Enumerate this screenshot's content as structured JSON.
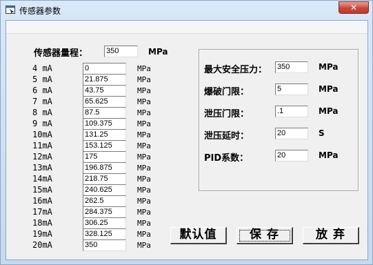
{
  "window": {
    "title": "传感器参数",
    "close_label": "✕"
  },
  "range": {
    "label": "传感器量程：",
    "value": "350",
    "unit": "MPa"
  },
  "table": {
    "rows": [
      {
        "label": "4 mA",
        "value": "0",
        "unit": "MPa"
      },
      {
        "label": "5 mA",
        "value": "21.875",
        "unit": "MPa"
      },
      {
        "label": "6 mA",
        "value": "43.75",
        "unit": "MPa"
      },
      {
        "label": "7 mA",
        "value": "65.625",
        "unit": "MPa"
      },
      {
        "label": "8 mA",
        "value": "87.5",
        "unit": "MPa"
      },
      {
        "label": "9 mA",
        "value": "109.375",
        "unit": "MPa"
      },
      {
        "label": "10mA",
        "value": "131.25",
        "unit": "MPa"
      },
      {
        "label": "11mA",
        "value": "153.125",
        "unit": "MPa"
      },
      {
        "label": "12mA",
        "value": "175",
        "unit": "MPa"
      },
      {
        "label": "13mA",
        "value": "196.875",
        "unit": "MPa"
      },
      {
        "label": "14mA",
        "value": "218.75",
        "unit": "MPa"
      },
      {
        "label": "15mA",
        "value": "240.625",
        "unit": "MPa"
      },
      {
        "label": "16mA",
        "value": "262.5",
        "unit": "MPa"
      },
      {
        "label": "17mA",
        "value": "284.375",
        "unit": "MPa"
      },
      {
        "label": "18mA",
        "value": "306.25",
        "unit": "MPa"
      },
      {
        "label": "19mA",
        "value": "328.125",
        "unit": "MPa"
      },
      {
        "label": "20mA",
        "value": "350",
        "unit": "MPa"
      }
    ]
  },
  "settings": {
    "items": [
      {
        "label": "最大安全压力：",
        "value": "350",
        "unit": "MPa"
      },
      {
        "label": "爆破门限：",
        "value": "5",
        "unit": "MPa"
      },
      {
        "label": "泄压门限：",
        "value": ".1",
        "unit": "MPa"
      },
      {
        "label": "泄压延时：",
        "value": "20",
        "unit": "S"
      },
      {
        "label": "PID系数：",
        "value": "20",
        "unit": "MPa"
      }
    ]
  },
  "buttons": {
    "default": "默认值",
    "save": "保 存",
    "discard": "放 弃"
  }
}
